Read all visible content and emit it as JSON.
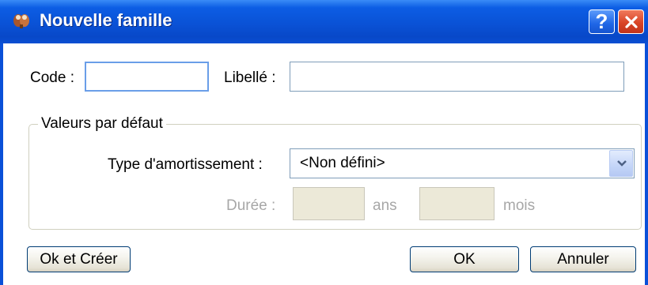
{
  "window": {
    "title": "Nouvelle famille",
    "help_label": "?",
    "close_label": "✕"
  },
  "form": {
    "code_label": "Code :",
    "code_value": "",
    "libelle_label": "Libellé :",
    "libelle_value": ""
  },
  "defaults_group": {
    "title": "Valeurs par défaut",
    "type_label": "Type d'amortissement :",
    "type_value": "<Non défini>",
    "duree_label": "Durée :",
    "ans_label": "ans",
    "mois_label": "mois",
    "ans_value": "",
    "mois_value": ""
  },
  "buttons": {
    "ok_create": "Ok et Créer",
    "ok": "OK",
    "cancel": "Annuler"
  },
  "colors": {
    "titlebar": "#0a52d6",
    "close": "#d94426",
    "disabled_text": "#a7a7a7"
  }
}
